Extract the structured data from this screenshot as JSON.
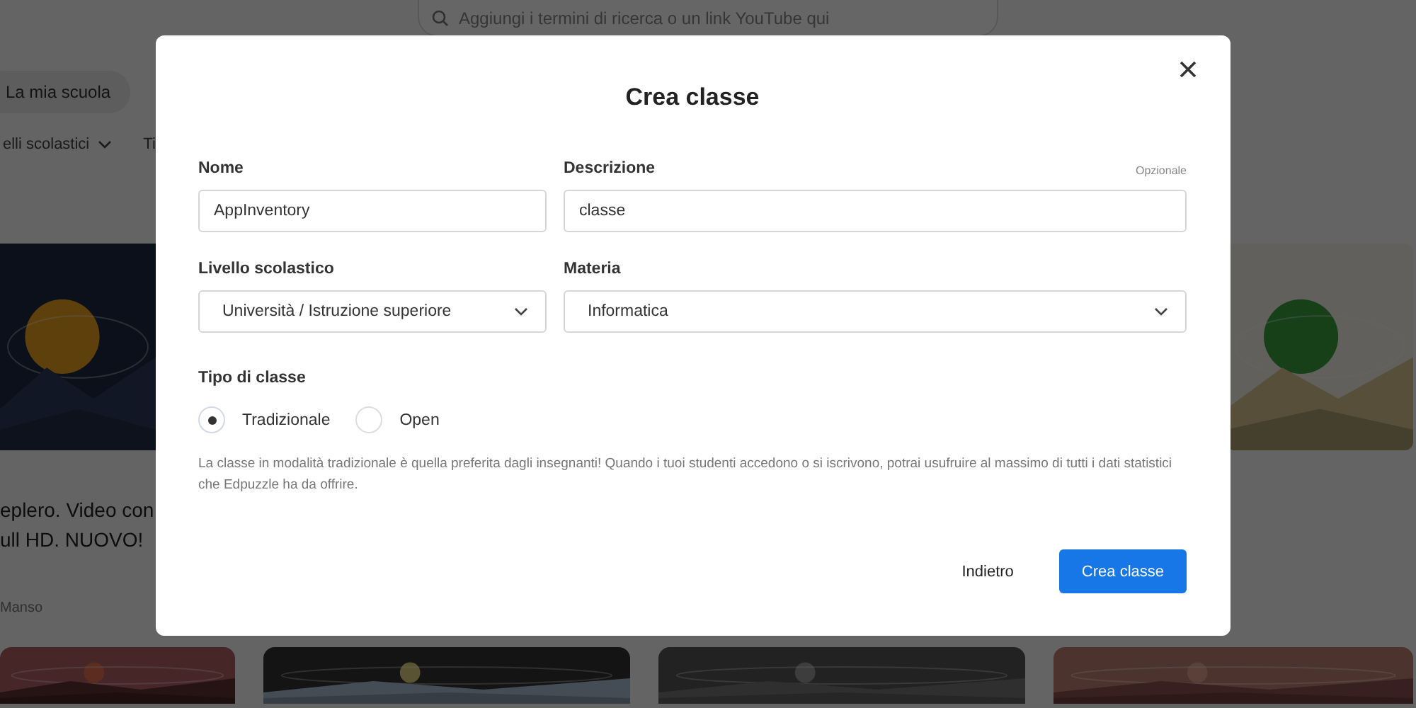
{
  "search": {
    "placeholder": "Aggiungi i termini di ricerca o un link YouTube qui"
  },
  "nav_chips": [
    {
      "label": "La mia scuola"
    }
  ],
  "filters": [
    {
      "label": "elli scolastici"
    },
    {
      "label": "Ti"
    }
  ],
  "video_card": {
    "title_lines": [
      "eplero. Video con",
      "ull HD. NUOVO!"
    ],
    "author": "Manso"
  },
  "dialog": {
    "title": "Crea classe",
    "fields": [
      {
        "kind": "text",
        "label": "Nome",
        "value": "AppInventory"
      },
      {
        "kind": "text",
        "label": "Descrizione",
        "value": "classe",
        "hint": "Opzionale"
      },
      {
        "kind": "select",
        "label": "Livello scolastico",
        "value": "Università / Istruzione superiore"
      },
      {
        "kind": "select",
        "label": "Materia",
        "value": "Informatica"
      }
    ],
    "class_type": {
      "label": "Tipo di classe",
      "options": [
        {
          "label": "Tradizionale",
          "selected": true
        },
        {
          "label": "Open",
          "selected": false
        }
      ],
      "help": "La classe in modalità tradizionale è quella preferita dagli insegnanti! Quando i tuoi studenti accedono o si iscrivono, potrai usufruire al massimo di tutti i dati statistici che Edpuzzle ha da offrire."
    },
    "buttons": [
      {
        "kind": "secondary",
        "label": "Indietro"
      },
      {
        "kind": "primary",
        "label": "Crea classe"
      }
    ]
  }
}
